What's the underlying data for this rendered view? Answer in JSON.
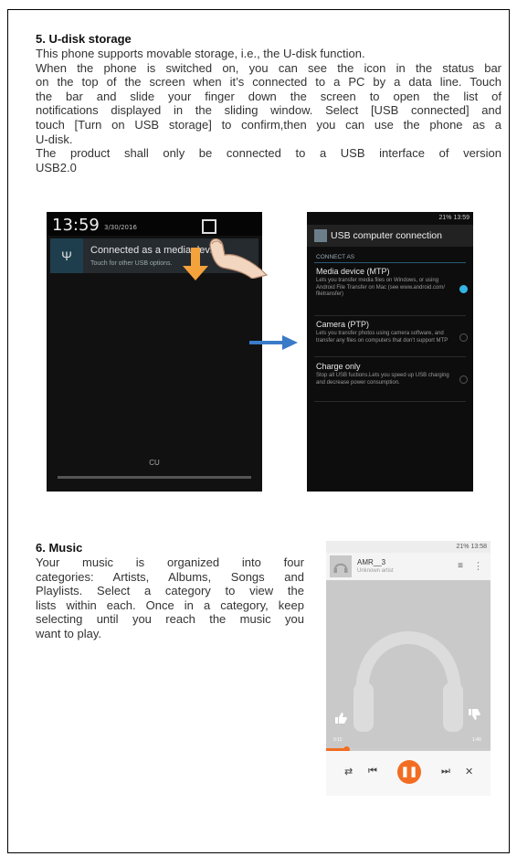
{
  "usb_section": {
    "title": "5. U-disk storage",
    "lines": [
      "This phone supports movable storage, i.e., the U-disk function.",
      "When the phone is  switched on, you can see the icon in the status bar",
      "on the top of the screen when it’s connected to a PC by a data line. Touch",
      "the bar and slide your finger down the screen to open the list of",
      "notifications displayed in the sliding window. Select [USB connected] and",
      "touch [Turn on USB storage] to confirm,then you can use the phone as a",
      "U-disk.",
      "The product shall only be connected to a USB interface of version",
      "USB2.0"
    ]
  },
  "phone1": {
    "clock": "13:59",
    "date": "3/30/2016",
    "notification_title": "Connected as a media device",
    "notification_sub": "Touch for other USB options.",
    "carrier": "CU"
  },
  "phone2": {
    "status": "21% 13:59",
    "title": "USB computer connection",
    "caption": "CONNECT AS",
    "options": [
      {
        "title": "Media device (MTP)",
        "desc": "Lets you transfer media files on Windows, or using Android File Transfer on Mac (see www.android.com/ filetransfer)"
      },
      {
        "title": "Camera (PTP)",
        "desc": "Lets you transfer photos using camera software, and transfer any files on computers that don't support MTP"
      },
      {
        "title": "Charge only",
        "desc": "Stop all USB fuctions.Lets you speed up USB charging and decrease power consumption."
      }
    ]
  },
  "music_section": {
    "title": "6. Music",
    "lines": [
      "Your music is organized into four",
      "categories: Artists, Albums, Songs and",
      "Playlists. Select a category to view the",
      "lists within each. Once in a category, keep",
      "selecting until you reach the music you",
      "want to play."
    ]
  },
  "phone3": {
    "status": "21% 13:58",
    "song": "AMR__3",
    "artist": "Unknown artist",
    "elapsed": "0:11",
    "duration": "1:40",
    "progress_fraction": 0.12
  }
}
